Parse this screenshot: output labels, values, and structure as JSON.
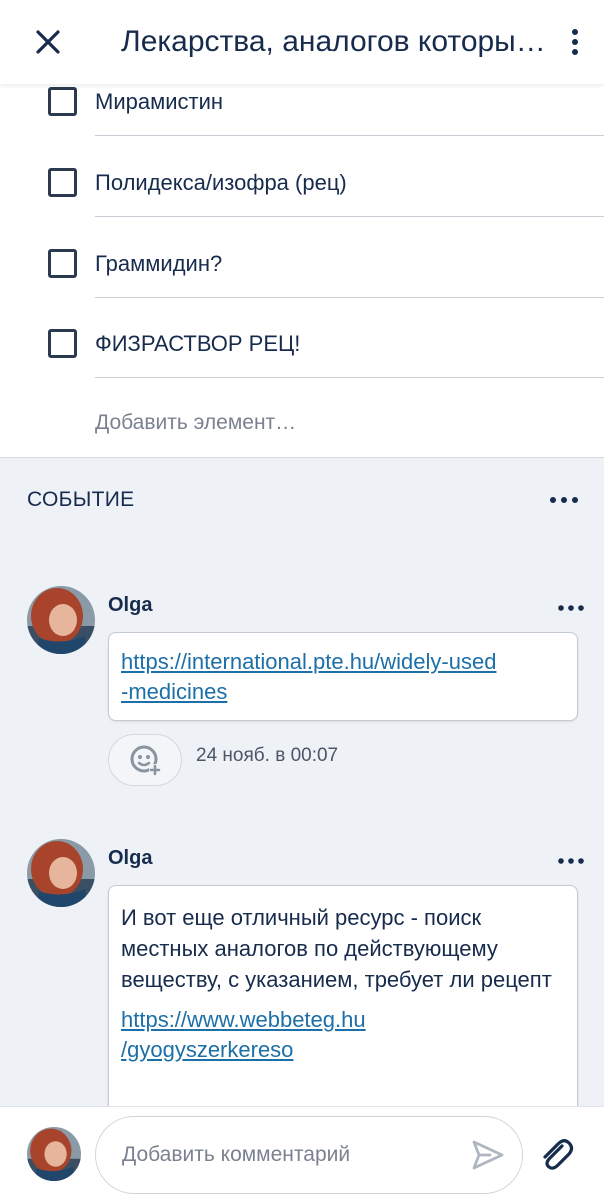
{
  "header": {
    "title": "Лекарства, аналогов которых нет в Венгрии",
    "close_icon": "close-icon",
    "more_icon": "more-vertical-icon"
  },
  "checklist": {
    "items": [
      {
        "label": "Мирамистин",
        "checked": false
      },
      {
        "label": "Полидекса/изофра (рец)",
        "checked": false
      },
      {
        "label": "Граммидин?",
        "checked": false
      },
      {
        "label": "ФИЗРАСТВОР РЕЦ!",
        "checked": false
      }
    ],
    "add_placeholder": "Добавить элемент…"
  },
  "activity": {
    "title": "СОБЫТИЕ",
    "comments": [
      {
        "author": "Olga",
        "link_line1": "https://international.pte.hu/widely-used",
        "link_line2": "-medicines",
        "timestamp": "24 нояб. в 00:07"
      },
      {
        "author": "Olga",
        "text": "И вот еще отличный ресурс - поиск местных аналогов по действующему веществу, с указанием, требует ли рецепт",
        "link_line1": "https://www.webbeteg.hu",
        "link_line2": "/gyogyszerkereso"
      }
    ]
  },
  "bottom_bar": {
    "comment_placeholder": "Добавить комментарий",
    "send_icon": "send-icon",
    "attach_icon": "paperclip-icon"
  },
  "colors": {
    "primary_text": "#172b4d",
    "link": "#1d6fa8",
    "background": "#eef1f6",
    "muted": "#7a8190"
  }
}
